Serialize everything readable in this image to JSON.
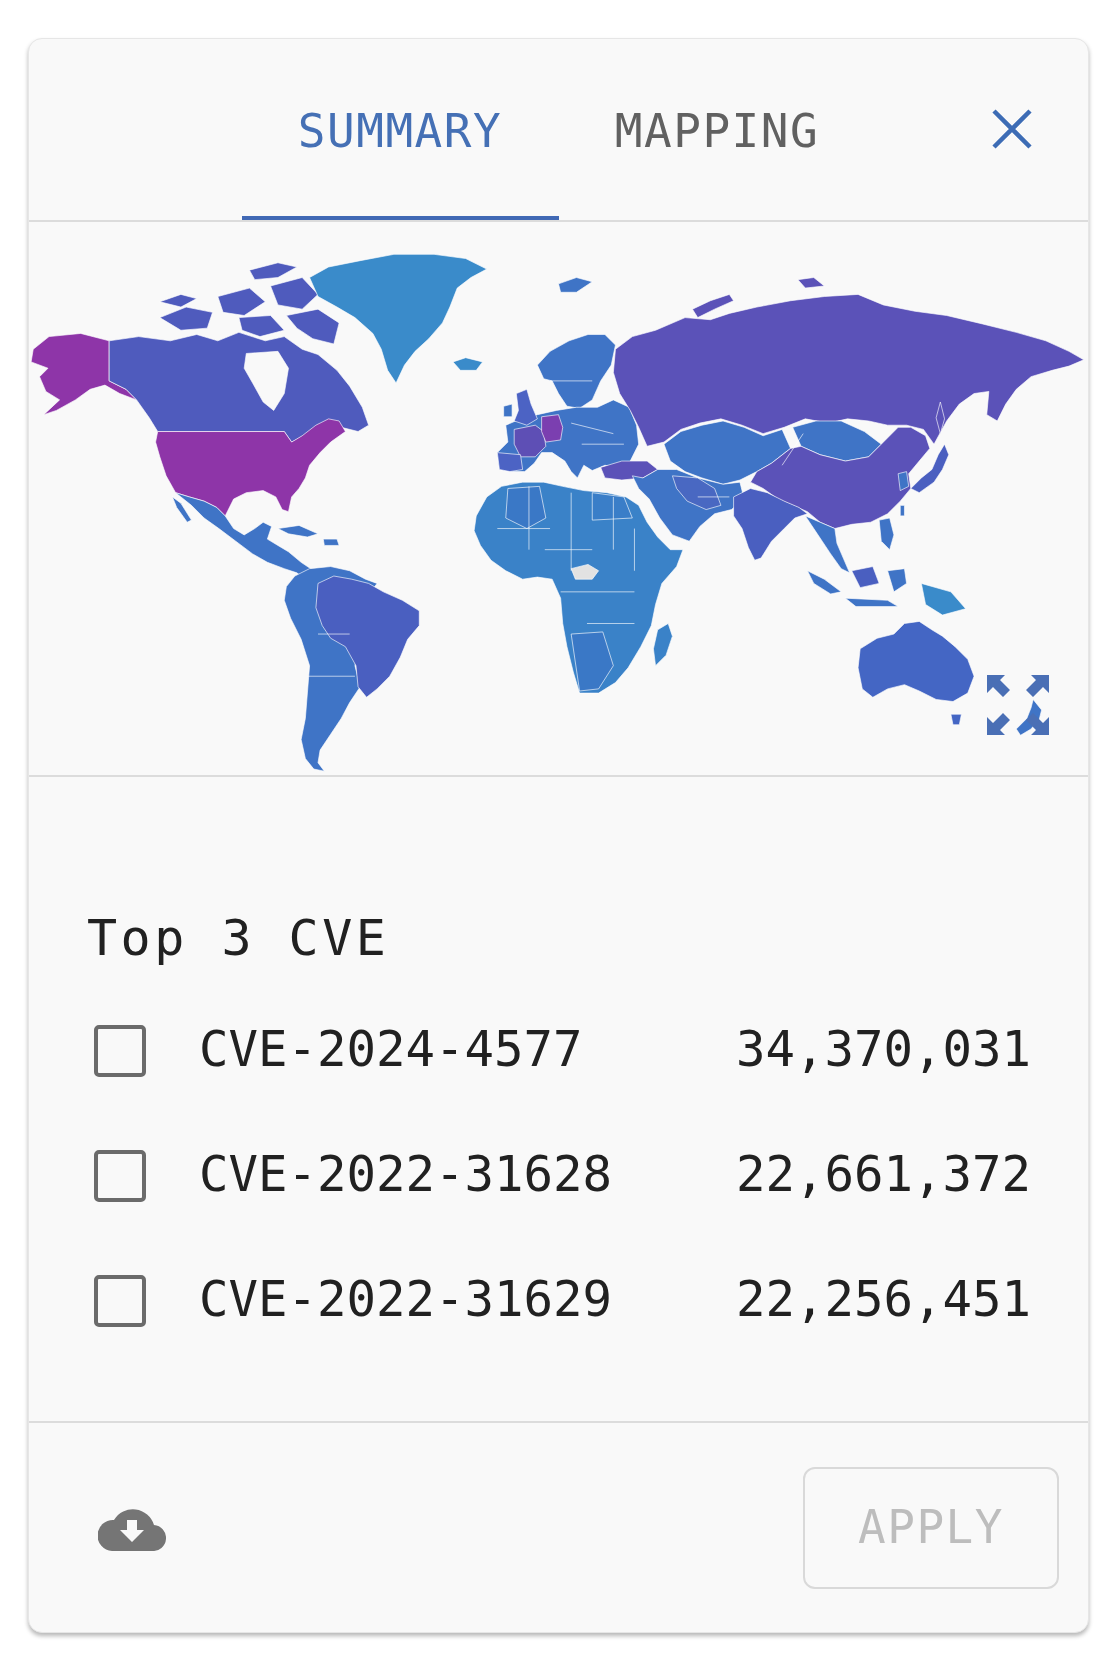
{
  "tabs": [
    {
      "label": "SUMMARY",
      "selected": true
    },
    {
      "label": "MAPPING",
      "selected": false
    }
  ],
  "top_cves": {
    "title": "Top 3 CVE",
    "items": [
      {
        "name": "CVE-2024-4577",
        "count": "34,370,031",
        "checked": false
      },
      {
        "name": "CVE-2022-31628",
        "count": "22,661,372",
        "checked": false
      },
      {
        "name": "CVE-2022-31629",
        "count": "22,256,451",
        "checked": false
      }
    ]
  },
  "footer": {
    "apply_button": {
      "label": "APPLY",
      "disabled": true
    }
  }
}
